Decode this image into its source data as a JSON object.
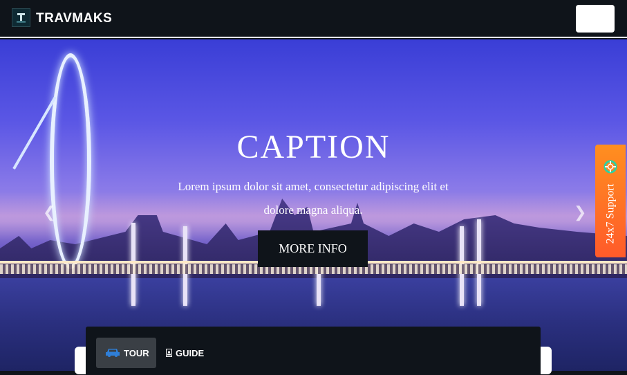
{
  "header": {
    "brand": "TRAVMAKS",
    "logo_icon": "travmaks-logo",
    "menu_icon": "menu-toggle"
  },
  "hero": {
    "title": "CAPTION",
    "text": "Lorem ipsum dolor sit amet, consectetur adipiscing elit et dolore magna aliqua.",
    "button": "MORE INFO",
    "prev_icon": "chevron-left",
    "next_icon": "chevron-right"
  },
  "support": {
    "label": "24x7 Support",
    "icon": "lifebuoy"
  },
  "booking": {
    "tabs": [
      {
        "label": "TOUR",
        "icon": "car"
      },
      {
        "label": "GUIDE",
        "icon": "id-card"
      }
    ]
  },
  "colors": {
    "nav_bg": "#0f141a",
    "support_orange": "#ff7a25",
    "tour_icon_blue": "#2f7fd8"
  }
}
